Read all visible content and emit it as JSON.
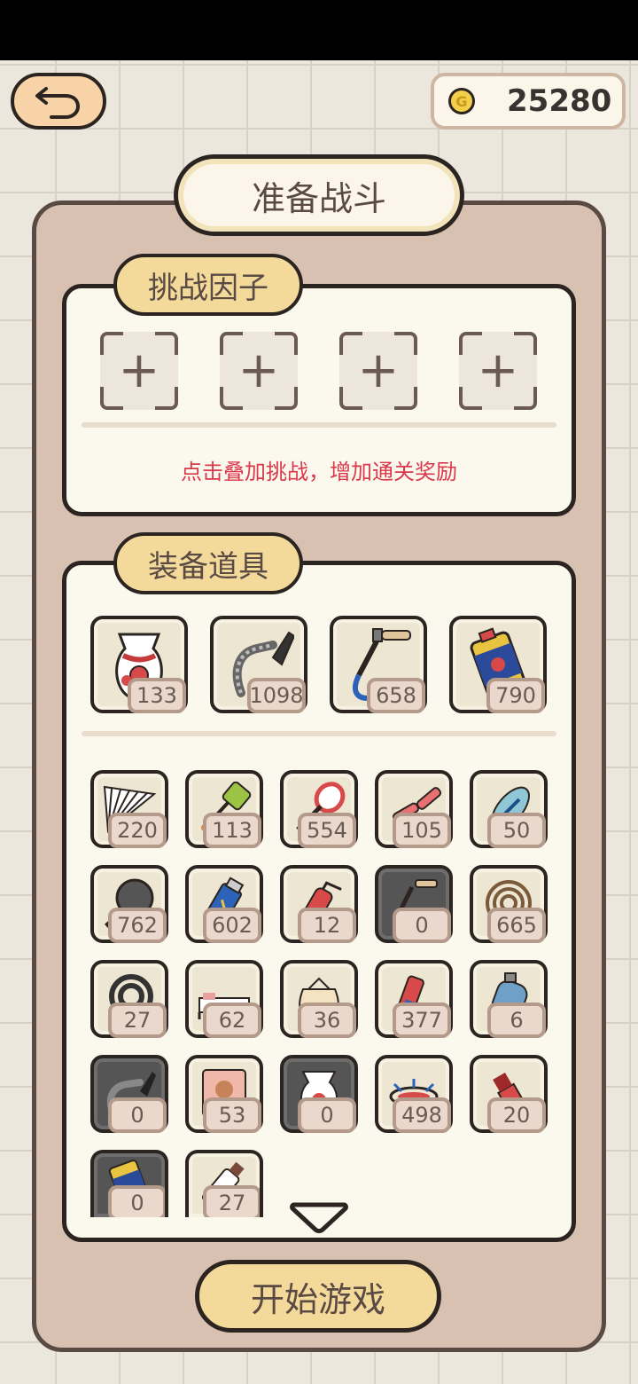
{
  "header": {
    "coins": "25280",
    "coin_symbol": "G"
  },
  "title": "准备战斗",
  "challenge": {
    "label": "挑战因子",
    "slot_symbol": "+",
    "hint": "点击叠加挑战，增加通关奖励"
  },
  "equip": {
    "label": "装备道具",
    "featured": [
      {
        "name": "vase",
        "count": "133"
      },
      {
        "name": "vacuum",
        "count": "1098"
      },
      {
        "name": "plunger",
        "count": "658"
      },
      {
        "name": "bug-spray-can",
        "count": "790"
      }
    ],
    "items": [
      {
        "name": "fan",
        "count": "220",
        "dark": false
      },
      {
        "name": "fly-swatter",
        "count": "113",
        "dark": false
      },
      {
        "name": "tennis-racket",
        "count": "554",
        "dark": false
      },
      {
        "name": "nunchucks",
        "count": "105",
        "dark": false
      },
      {
        "name": "flip-flop",
        "count": "50",
        "dark": false
      },
      {
        "name": "frying-pan",
        "count": "762",
        "dark": false
      },
      {
        "name": "spray-can",
        "count": "602",
        "dark": false
      },
      {
        "name": "fire-extinguisher",
        "count": "12",
        "dark": false
      },
      {
        "name": "plunger",
        "count": "0",
        "dark": true
      },
      {
        "name": "mosquito-coil",
        "count": "665",
        "dark": false
      },
      {
        "name": "coil",
        "count": "27",
        "dark": false
      },
      {
        "name": "bed",
        "count": "62",
        "dark": false
      },
      {
        "name": "sack",
        "count": "36",
        "dark": false
      },
      {
        "name": "firecracker",
        "count": "377",
        "dark": false
      },
      {
        "name": "gas-tank",
        "count": "6",
        "dark": false
      },
      {
        "name": "vacuum",
        "count": "0",
        "dark": true
      },
      {
        "name": "bear-card",
        "count": "53",
        "dark": false
      },
      {
        "name": "vase",
        "count": "0",
        "dark": true
      },
      {
        "name": "electric-racket",
        "count": "498",
        "dark": false
      },
      {
        "name": "lipstick",
        "count": "20",
        "dark": false
      },
      {
        "name": "bug-spray-can",
        "count": "0",
        "dark": true
      },
      {
        "name": "bottle",
        "count": "27",
        "dark": false
      }
    ]
  },
  "start_label": "开始游戏"
}
